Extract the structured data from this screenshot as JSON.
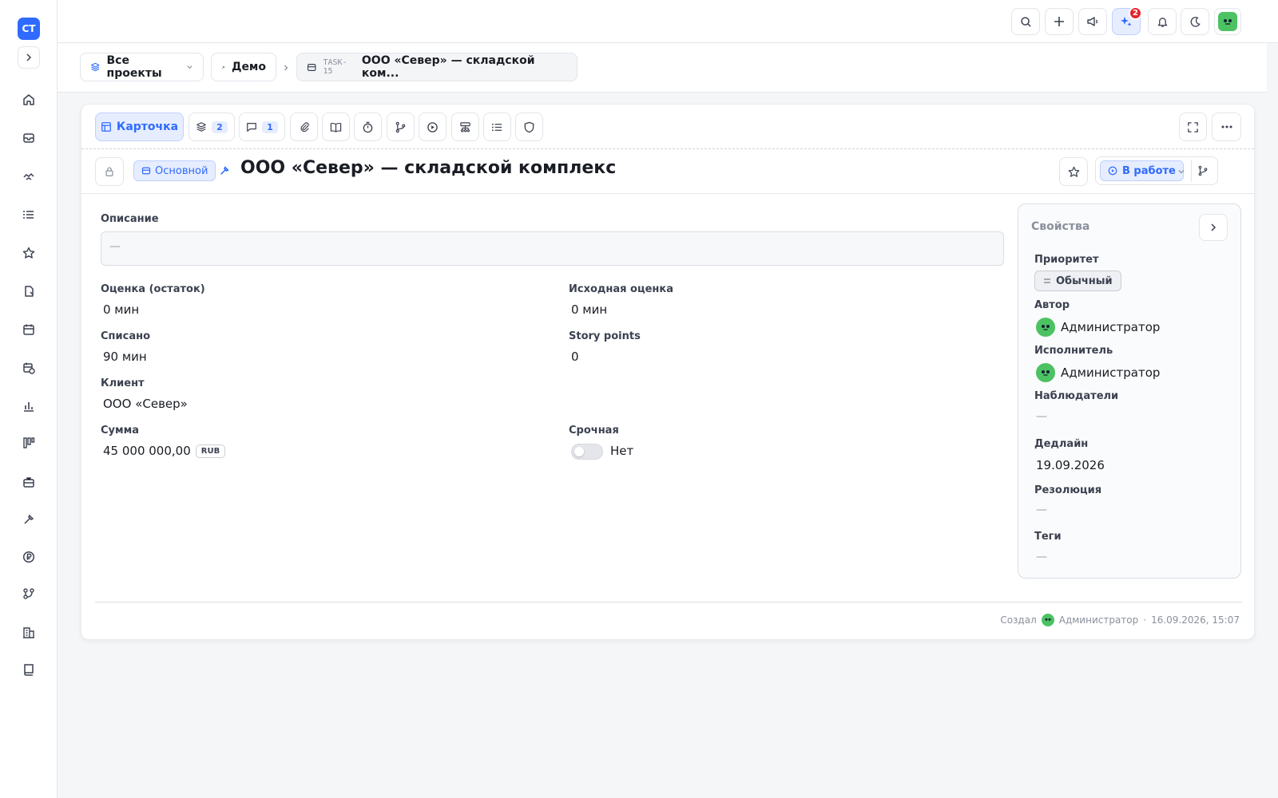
{
  "app": {
    "logo": "СТ"
  },
  "topbar": {
    "notifications_badge": "2"
  },
  "breadcrumbs": {
    "projects": "Все проекты",
    "project": "Демо",
    "task_id": "TASK-15",
    "task_title": "ООО «Север» — складской ком..."
  },
  "tabs": {
    "card": "Карточка",
    "subtasks_count": "2",
    "comments_count": "1"
  },
  "task": {
    "type_label": "Основной",
    "title": "ООО «Север» — складской комплекс",
    "status": "В работе"
  },
  "fields": {
    "description_label": "Описание",
    "description_value": "—",
    "estimate_remaining_label": "Оценка (остаток)",
    "estimate_remaining_value": "0 мин",
    "original_estimate_label": "Исходная оценка",
    "original_estimate_value": "0 мин",
    "logged_label": "Списано",
    "logged_value": "90 мин",
    "story_points_label": "Story points",
    "story_points_value": "0",
    "client_label": "Клиент",
    "client_value": "ООО «Север»",
    "amount_label": "Сумма",
    "amount_value": "45 000 000,00",
    "amount_currency": "RUB",
    "urgent_label": "Срочная",
    "urgent_value": "Нет"
  },
  "properties": {
    "header": "Свойства",
    "priority_label": "Приоритет",
    "priority_value": "Обычный",
    "author_label": "Автор",
    "author_value": "Администратор",
    "assignee_label": "Исполнитель",
    "assignee_value": "Администратор",
    "watchers_label": "Наблюдатели",
    "watchers_value": "—",
    "deadline_label": "Дедлайн",
    "deadline_value": "19.09.2026",
    "resolution_label": "Резолюция",
    "resolution_value": "—",
    "tags_label": "Теги",
    "tags_value": "—"
  },
  "footer": {
    "created_label": "Создал",
    "created_by": "Администратор",
    "separator": "·",
    "created_at": "16.09.2026, 15:07"
  },
  "colors": {
    "accent": "#2f6bff",
    "badge": "#e5252d",
    "avatar": "#4cc262"
  },
  "icons": [
    "home-icon",
    "inbox-icon",
    "handshake-icon",
    "list-icon",
    "star-icon",
    "document-icon",
    "calendar-icon",
    "calendar-clock-icon",
    "chart-icon",
    "kanban-icon",
    "briefcase-icon",
    "tools-icon",
    "ruble-icon",
    "workflow-icon",
    "building-icon",
    "book-icon"
  ]
}
